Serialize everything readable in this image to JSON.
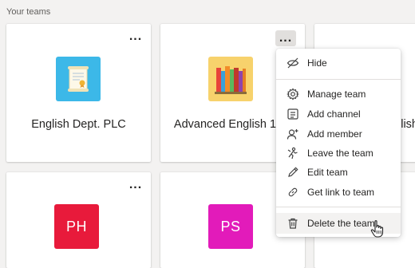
{
  "section_title": "Your teams",
  "more_options_label": "...",
  "teams": [
    {
      "name": "English Dept. PLC",
      "logo": "scroll-certificate-icon",
      "logo_bg": "#3cb8e8"
    },
    {
      "name": "Advanced English 11",
      "logo": "books-icon",
      "logo_bg": "#f7d26c"
    },
    {
      "name": "...lish",
      "logo": "hidden",
      "logo_bg": ""
    },
    {
      "initials": "PH",
      "logo_bg": "#e81a3b"
    },
    {
      "initials": "PS",
      "logo_bg": "#e21bba"
    }
  ],
  "context_menu": {
    "items": [
      {
        "label": "Hide",
        "icon": "hide-icon"
      },
      {
        "label": "Manage team",
        "icon": "gear-icon"
      },
      {
        "label": "Add channel",
        "icon": "channel-icon"
      },
      {
        "label": "Add member",
        "icon": "add-person-icon"
      },
      {
        "label": "Leave the team",
        "icon": "leave-icon"
      },
      {
        "label": "Edit team",
        "icon": "pencil-icon"
      },
      {
        "label": "Get link to team",
        "icon": "link-icon"
      },
      {
        "label": "Delete the team",
        "icon": "trash-icon"
      }
    ]
  },
  "colors": {
    "background": "#f3f2f1",
    "card": "#ffffff",
    "menu_hover": "#f3f2f1"
  }
}
